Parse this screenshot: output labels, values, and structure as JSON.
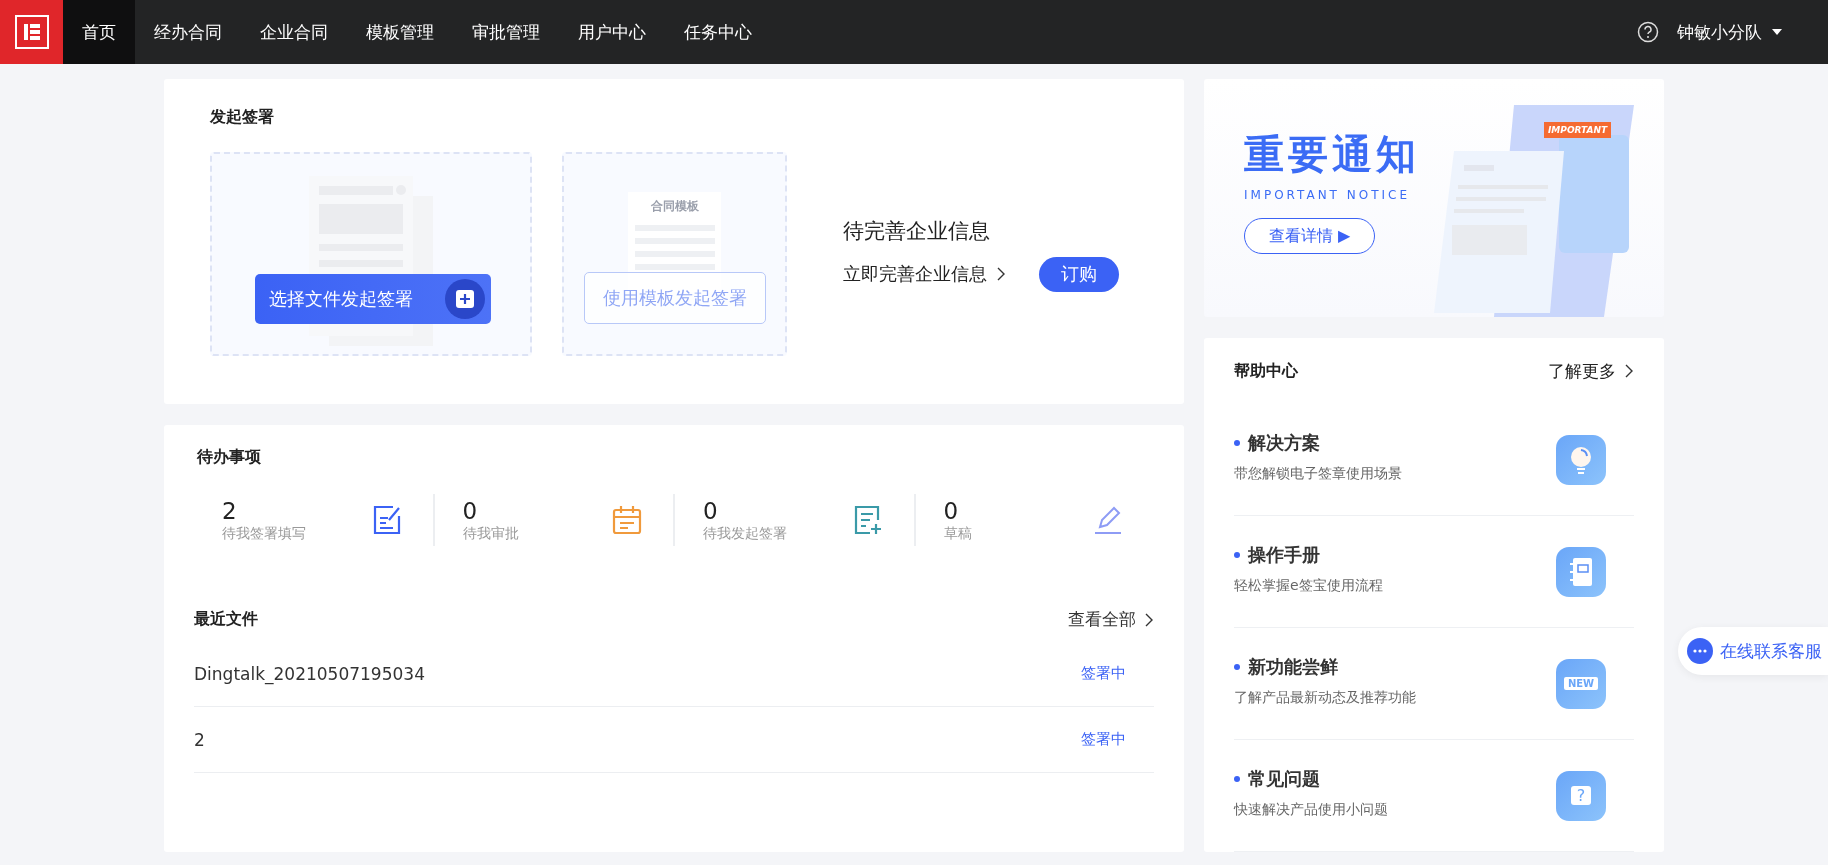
{
  "nav": {
    "items": [
      {
        "label": "首页",
        "selected": true
      },
      {
        "label": "经办合同",
        "selected": false
      },
      {
        "label": "企业合同",
        "selected": false
      },
      {
        "label": "模板管理",
        "selected": false
      },
      {
        "label": "审批管理",
        "selected": false
      },
      {
        "label": "用户中心",
        "selected": false
      },
      {
        "label": "任务中心",
        "selected": false
      }
    ],
    "user": "钟敏小分队"
  },
  "start_signing": {
    "title": "发起签署",
    "file_button": "选择文件发起签署",
    "template_label": "合同模板",
    "template_button": "使用模板发起签署",
    "pending_title": "待完善企业信息",
    "pending_link": "立即完善企业信息",
    "order_button": "订购"
  },
  "todo": {
    "title": "待办事项",
    "stats": [
      {
        "count": "2",
        "label": "待我签署填写",
        "kind": "sign"
      },
      {
        "count": "0",
        "label": "待我审批",
        "kind": "approve"
      },
      {
        "count": "0",
        "label": "待我发起签署",
        "kind": "start"
      },
      {
        "count": "0",
        "label": "草稿",
        "kind": "draft"
      }
    ]
  },
  "recent": {
    "title": "最近文件",
    "view_all": "查看全部",
    "rows": [
      {
        "name": "Dingtalk_20210507195034",
        "status": "签署中"
      },
      {
        "name": "2",
        "status": "签署中"
      }
    ]
  },
  "banner": {
    "title": "重要通知",
    "subtitle": "IMPORTANT NOTICE",
    "button": "查看详情 ▶",
    "tag": "IMPORTANT"
  },
  "help": {
    "title": "帮助中心",
    "more": "了解更多",
    "items": [
      {
        "title": "解决方案",
        "desc": "带您解锁电子签章使用场景",
        "kind": "bulb"
      },
      {
        "title": "操作手册",
        "desc": "轻松掌握e签宝使用流程",
        "kind": "book"
      },
      {
        "title": "新功能尝鲜",
        "desc": "了解产品最新动态及推荐功能",
        "kind": "new",
        "badge": "NEW"
      },
      {
        "title": "常见问题",
        "desc": "快速解决产品使用小问题",
        "kind": "question",
        "badge": "?"
      }
    ]
  },
  "chat": {
    "label": "在线联系客服"
  }
}
